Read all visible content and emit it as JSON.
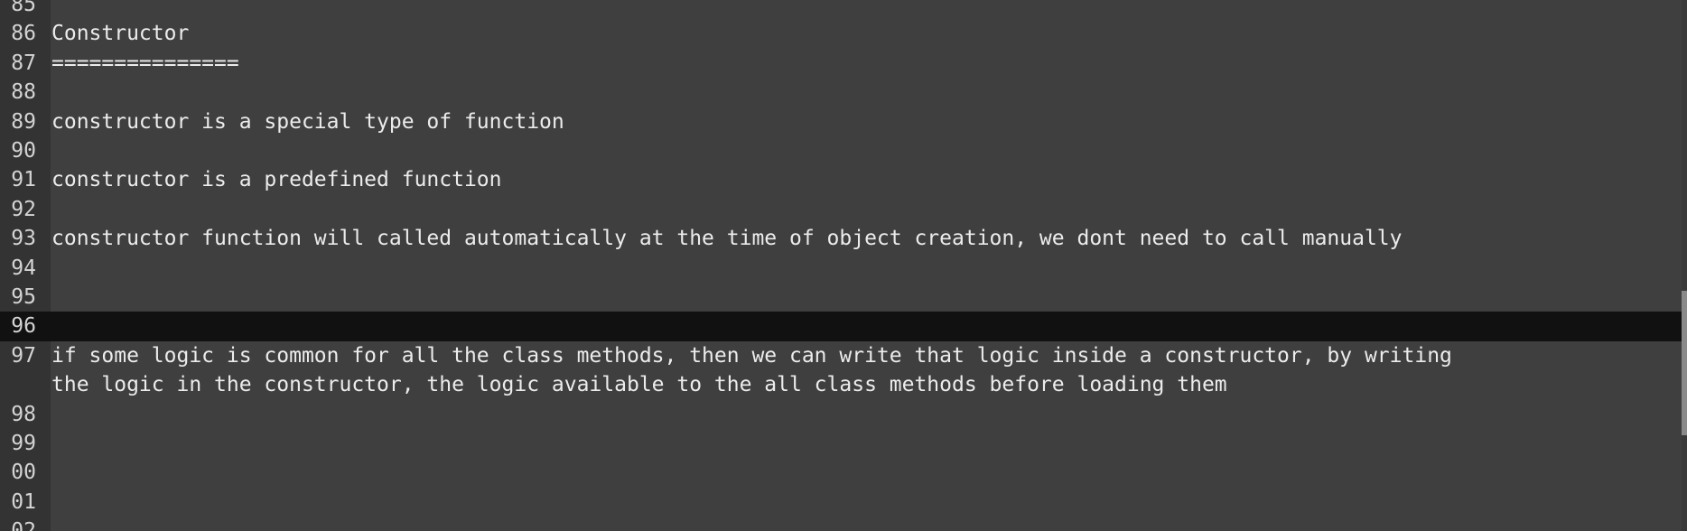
{
  "editor": {
    "lines": [
      {
        "num": "85",
        "text": ""
      },
      {
        "num": "86",
        "text": "Constructor"
      },
      {
        "num": "87",
        "text": "==============="
      },
      {
        "num": "88",
        "text": ""
      },
      {
        "num": "89",
        "text": "constructor is a special type of function"
      },
      {
        "num": "90",
        "text": ""
      },
      {
        "num": "91",
        "text": "constructor is a predefined function"
      },
      {
        "num": "92",
        "text": ""
      },
      {
        "num": "93",
        "text": "constructor function will called automatically at the time of object creation, we dont need to call manually"
      },
      {
        "num": "94",
        "text": ""
      },
      {
        "num": "95",
        "text": ""
      },
      {
        "num": "96",
        "text": "",
        "current": true
      },
      {
        "num": "97",
        "text": "if some logic is common for all the class methods, then we can write that logic inside a constructor, by writing"
      },
      {
        "num": "",
        "text": "the logic in the constructor, the logic available to the all class methods before loading them"
      },
      {
        "num": "98",
        "text": ""
      },
      {
        "num": "99",
        "text": ""
      },
      {
        "num": "00",
        "text": ""
      },
      {
        "num": "01",
        "text": ""
      },
      {
        "num": "02",
        "text": ""
      }
    ]
  },
  "colors": {
    "background": "#3f3f3f",
    "gutter": "#333333",
    "current_line": "#111111",
    "text": "#ececec",
    "line_number": "#d4d4d4"
  }
}
